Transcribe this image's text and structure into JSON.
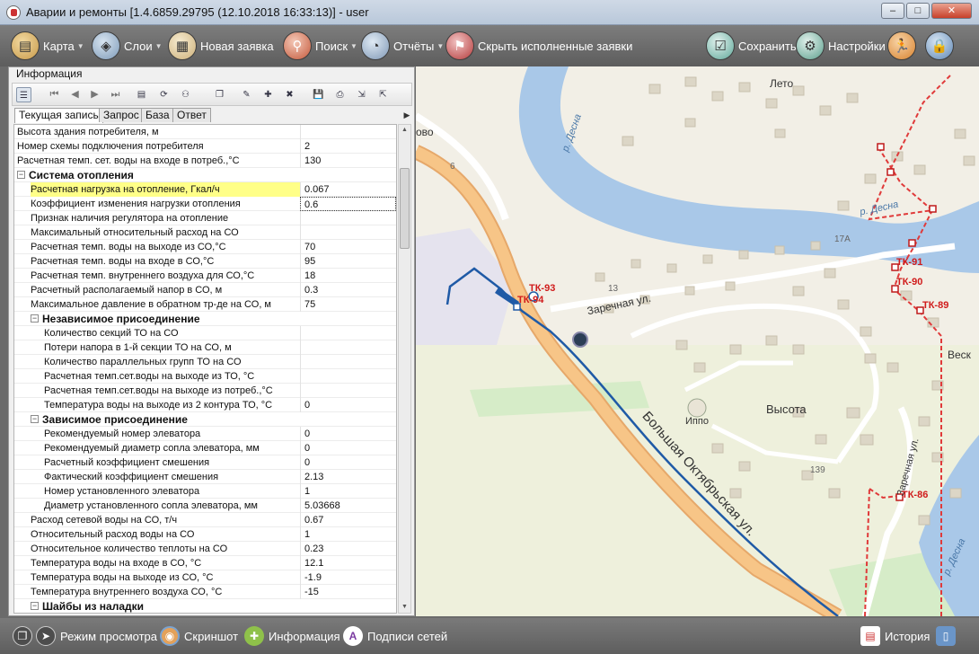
{
  "window": {
    "title": "Аварии и ремонты [1.4.6859.29795 (12.10.2018 16:33:13)] - user",
    "minimize": "–",
    "maximize": "□",
    "close": "✕"
  },
  "toolbar": {
    "map": "Карта",
    "layers": "Слои",
    "new_request": "Новая заявка",
    "search": "Поиск",
    "reports": "Отчёты",
    "hide_done": "Скрыть исполненные заявки",
    "save": "Сохранить",
    "settings": "Настройки"
  },
  "info_panel": {
    "title": "Информация",
    "tabs": [
      "Текущая запись",
      "Запрос",
      "База",
      "Ответ"
    ],
    "rows": [
      {
        "indent": 0,
        "name": "Высота здания потребителя, м",
        "value": ""
      },
      {
        "indent": 0,
        "name": "Номер схемы подключения потребителя",
        "value": "2"
      },
      {
        "indent": 0,
        "name": "Расчетная темп. сет. воды на входе в потреб.,°С",
        "value": "130"
      },
      {
        "indent": 0,
        "group": true,
        "name": "Система отопления"
      },
      {
        "indent": 1,
        "name": "Расчетная нагрузка на отопление, Гкал/ч",
        "value": "0.067",
        "highlight": true
      },
      {
        "indent": 1,
        "name": "Коэффициент изменения нагрузки отопления",
        "value": "0.6",
        "edit": true
      },
      {
        "indent": 1,
        "name": "Признак наличия регулятора на отопление",
        "value": ""
      },
      {
        "indent": 1,
        "name": "Максимальный относительный расход на СО",
        "value": ""
      },
      {
        "indent": 1,
        "name": "Расчетная темп. воды на выходе из СО,°С",
        "value": "70"
      },
      {
        "indent": 1,
        "name": "Расчетная темп. воды на входе в СО,°С",
        "value": "95"
      },
      {
        "indent": 1,
        "name": "Расчетная темп. внутреннего воздуха для СО,°С",
        "value": "18"
      },
      {
        "indent": 1,
        "name": "Расчетный располагаемый напор в СО, м",
        "value": "0.3"
      },
      {
        "indent": 1,
        "name": "Максимальное давление в обратном тр-де на СО, м",
        "value": "75"
      },
      {
        "indent": 1,
        "group": true,
        "name": "Независимое присоединение"
      },
      {
        "indent": 2,
        "name": "Количество секций ТО на СО",
        "value": ""
      },
      {
        "indent": 2,
        "name": "Потери напора в 1-й секции ТО на СО, м",
        "value": ""
      },
      {
        "indent": 2,
        "name": "Количество параллельных групп ТО на СО",
        "value": ""
      },
      {
        "indent": 2,
        "name": "Расчетная темп.сет.воды на выходе из ТО, °С",
        "value": ""
      },
      {
        "indent": 2,
        "name": "Расчетная темп.сет.воды на выходе из потреб.,°С",
        "value": ""
      },
      {
        "indent": 2,
        "name": "Температура  воды на  выходе из 2 контура ТО, °С",
        "value": "0"
      },
      {
        "indent": 1,
        "group": true,
        "name": "Зависимое присоединение"
      },
      {
        "indent": 2,
        "name": "Рекомендуемый номер элеватора",
        "value": "0"
      },
      {
        "indent": 2,
        "name": "Рекомендуемый диаметр сопла элеватора, мм",
        "value": "0"
      },
      {
        "indent": 2,
        "name": "Расчетный коэффициент смешения",
        "value": "0"
      },
      {
        "indent": 2,
        "name": "Фактический коэффициент смешения",
        "value": "2.13"
      },
      {
        "indent": 2,
        "name": "Номер установленного элеватора",
        "value": "1"
      },
      {
        "indent": 2,
        "name": "Диаметр установленного сопла элеватора, мм",
        "value": "5.03668"
      },
      {
        "indent": 1,
        "name": "Расход сетевой воды на СО, т/ч",
        "value": "0.67"
      },
      {
        "indent": 1,
        "name": "Относительный расход воды на СО",
        "value": "1"
      },
      {
        "indent": 1,
        "name": "Относительное количество теплоты на СО",
        "value": "0.23"
      },
      {
        "indent": 1,
        "name": "Температура воды на  входе в СО, °С",
        "value": "12.1"
      },
      {
        "indent": 1,
        "name": "Температура воды на выходе из СО, °С",
        "value": "-1.9"
      },
      {
        "indent": 1,
        "name": "Температура внутреннего воздуха СО, °С",
        "value": "-15"
      },
      {
        "indent": 1,
        "group": true,
        "name": "Шайбы из наладки"
      }
    ]
  },
  "map": {
    "places": {
      "leto": "Лето",
      "vysota": "Высота",
      "ippo": "Иппо",
      "vesk": "Веск",
      "ovo": "ово"
    },
    "streets": {
      "zarechnaya": "Заречная ул.",
      "zarechnaya2": "Заречная ул.",
      "bolshaya": "Большая Октябрьская ул."
    },
    "rivers": {
      "r1": "р. Десна",
      "r2": "р. Десна",
      "r3": "р. Десна"
    },
    "numbers": {
      "n6": "6",
      "n13": "13",
      "n17a": "17А",
      "n139": "139"
    },
    "nodes": {
      "tk93": "ТК-93",
      "tk94": "ТК-94",
      "tk91": "ТК-91",
      "tk90": "ТК-90",
      "tk89": "ТК-89",
      "tk86": "ТК-86"
    }
  },
  "statusbar": {
    "view_mode": "Режим просмотра",
    "screenshot": "Скриншот",
    "info": "Информация",
    "net_labels": "Подписи сетей",
    "history": "История"
  }
}
